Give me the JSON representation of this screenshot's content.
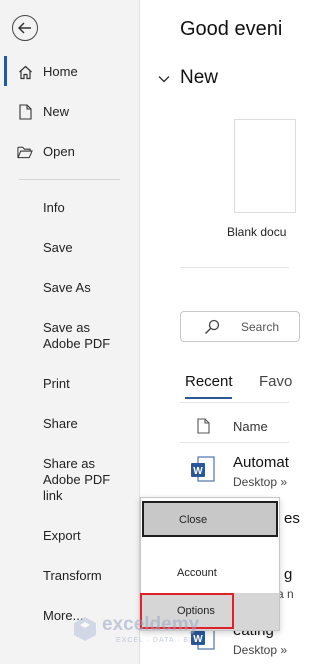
{
  "sidebar": {
    "back_icon": "back-arrow-icon",
    "items": [
      {
        "label": "Home",
        "icon": "home-icon"
      },
      {
        "label": "New",
        "icon": "new-document-icon"
      },
      {
        "label": "Open",
        "icon": "open-folder-icon"
      },
      {
        "label": "Info"
      },
      {
        "label": "Save"
      },
      {
        "label": "Save As"
      },
      {
        "label": "Save as Adobe PDF"
      },
      {
        "label": "Print"
      },
      {
        "label": "Share"
      },
      {
        "label": "Share as Adobe PDF link"
      },
      {
        "label": "Export"
      },
      {
        "label": "Transform"
      },
      {
        "label": "More..."
      }
    ],
    "accent": "#2b579a"
  },
  "main": {
    "greeting": "Good eveni",
    "new_section": "New",
    "blank_doc_label": "Blank docu",
    "search_placeholder": "Search",
    "tabs": [
      "Recent",
      "Favo"
    ],
    "column_name": "Name",
    "files": [
      {
        "name": "Automat",
        "location": "Desktop »"
      },
      {
        "name": "es",
        "location": ""
      },
      {
        "name": "g",
        "location": "a n"
      },
      {
        "name": "eating",
        "location": "Desktop »"
      }
    ]
  },
  "popup": {
    "items": [
      "Close",
      "Account",
      "Options"
    ],
    "highlight_color": "#e0202a"
  },
  "watermark": {
    "name": "exceldemy",
    "tagline": "EXCEL · DATA · BI"
  }
}
